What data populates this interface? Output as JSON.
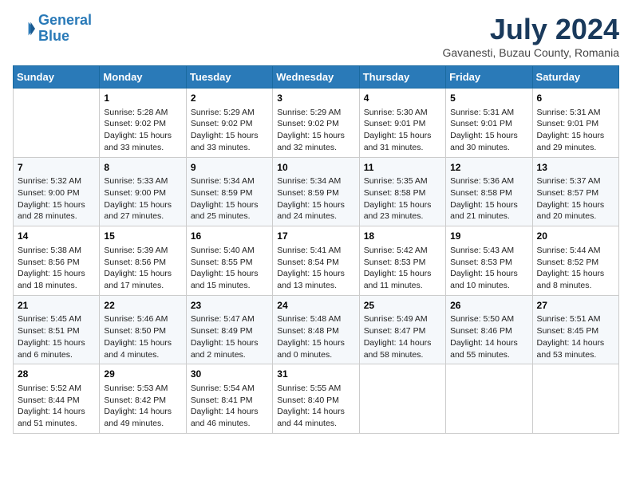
{
  "header": {
    "logo_line1": "General",
    "logo_line2": "Blue",
    "month": "July 2024",
    "location": "Gavanesti, Buzau County, Romania"
  },
  "weekdays": [
    "Sunday",
    "Monday",
    "Tuesday",
    "Wednesday",
    "Thursday",
    "Friday",
    "Saturday"
  ],
  "weeks": [
    [
      {
        "day": "",
        "content": ""
      },
      {
        "day": "1",
        "content": "Sunrise: 5:28 AM\nSunset: 9:02 PM\nDaylight: 15 hours\nand 33 minutes."
      },
      {
        "day": "2",
        "content": "Sunrise: 5:29 AM\nSunset: 9:02 PM\nDaylight: 15 hours\nand 33 minutes."
      },
      {
        "day": "3",
        "content": "Sunrise: 5:29 AM\nSunset: 9:02 PM\nDaylight: 15 hours\nand 32 minutes."
      },
      {
        "day": "4",
        "content": "Sunrise: 5:30 AM\nSunset: 9:01 PM\nDaylight: 15 hours\nand 31 minutes."
      },
      {
        "day": "5",
        "content": "Sunrise: 5:31 AM\nSunset: 9:01 PM\nDaylight: 15 hours\nand 30 minutes."
      },
      {
        "day": "6",
        "content": "Sunrise: 5:31 AM\nSunset: 9:01 PM\nDaylight: 15 hours\nand 29 minutes."
      }
    ],
    [
      {
        "day": "7",
        "content": "Sunrise: 5:32 AM\nSunset: 9:00 PM\nDaylight: 15 hours\nand 28 minutes."
      },
      {
        "day": "8",
        "content": "Sunrise: 5:33 AM\nSunset: 9:00 PM\nDaylight: 15 hours\nand 27 minutes."
      },
      {
        "day": "9",
        "content": "Sunrise: 5:34 AM\nSunset: 8:59 PM\nDaylight: 15 hours\nand 25 minutes."
      },
      {
        "day": "10",
        "content": "Sunrise: 5:34 AM\nSunset: 8:59 PM\nDaylight: 15 hours\nand 24 minutes."
      },
      {
        "day": "11",
        "content": "Sunrise: 5:35 AM\nSunset: 8:58 PM\nDaylight: 15 hours\nand 23 minutes."
      },
      {
        "day": "12",
        "content": "Sunrise: 5:36 AM\nSunset: 8:58 PM\nDaylight: 15 hours\nand 21 minutes."
      },
      {
        "day": "13",
        "content": "Sunrise: 5:37 AM\nSunset: 8:57 PM\nDaylight: 15 hours\nand 20 minutes."
      }
    ],
    [
      {
        "day": "14",
        "content": "Sunrise: 5:38 AM\nSunset: 8:56 PM\nDaylight: 15 hours\nand 18 minutes."
      },
      {
        "day": "15",
        "content": "Sunrise: 5:39 AM\nSunset: 8:56 PM\nDaylight: 15 hours\nand 17 minutes."
      },
      {
        "day": "16",
        "content": "Sunrise: 5:40 AM\nSunset: 8:55 PM\nDaylight: 15 hours\nand 15 minutes."
      },
      {
        "day": "17",
        "content": "Sunrise: 5:41 AM\nSunset: 8:54 PM\nDaylight: 15 hours\nand 13 minutes."
      },
      {
        "day": "18",
        "content": "Sunrise: 5:42 AM\nSunset: 8:53 PM\nDaylight: 15 hours\nand 11 minutes."
      },
      {
        "day": "19",
        "content": "Sunrise: 5:43 AM\nSunset: 8:53 PM\nDaylight: 15 hours\nand 10 minutes."
      },
      {
        "day": "20",
        "content": "Sunrise: 5:44 AM\nSunset: 8:52 PM\nDaylight: 15 hours\nand 8 minutes."
      }
    ],
    [
      {
        "day": "21",
        "content": "Sunrise: 5:45 AM\nSunset: 8:51 PM\nDaylight: 15 hours\nand 6 minutes."
      },
      {
        "day": "22",
        "content": "Sunrise: 5:46 AM\nSunset: 8:50 PM\nDaylight: 15 hours\nand 4 minutes."
      },
      {
        "day": "23",
        "content": "Sunrise: 5:47 AM\nSunset: 8:49 PM\nDaylight: 15 hours\nand 2 minutes."
      },
      {
        "day": "24",
        "content": "Sunrise: 5:48 AM\nSunset: 8:48 PM\nDaylight: 15 hours\nand 0 minutes."
      },
      {
        "day": "25",
        "content": "Sunrise: 5:49 AM\nSunset: 8:47 PM\nDaylight: 14 hours\nand 58 minutes."
      },
      {
        "day": "26",
        "content": "Sunrise: 5:50 AM\nSunset: 8:46 PM\nDaylight: 14 hours\nand 55 minutes."
      },
      {
        "day": "27",
        "content": "Sunrise: 5:51 AM\nSunset: 8:45 PM\nDaylight: 14 hours\nand 53 minutes."
      }
    ],
    [
      {
        "day": "28",
        "content": "Sunrise: 5:52 AM\nSunset: 8:44 PM\nDaylight: 14 hours\nand 51 minutes."
      },
      {
        "day": "29",
        "content": "Sunrise: 5:53 AM\nSunset: 8:42 PM\nDaylight: 14 hours\nand 49 minutes."
      },
      {
        "day": "30",
        "content": "Sunrise: 5:54 AM\nSunset: 8:41 PM\nDaylight: 14 hours\nand 46 minutes."
      },
      {
        "day": "31",
        "content": "Sunrise: 5:55 AM\nSunset: 8:40 PM\nDaylight: 14 hours\nand 44 minutes."
      },
      {
        "day": "",
        "content": ""
      },
      {
        "day": "",
        "content": ""
      },
      {
        "day": "",
        "content": ""
      }
    ]
  ]
}
